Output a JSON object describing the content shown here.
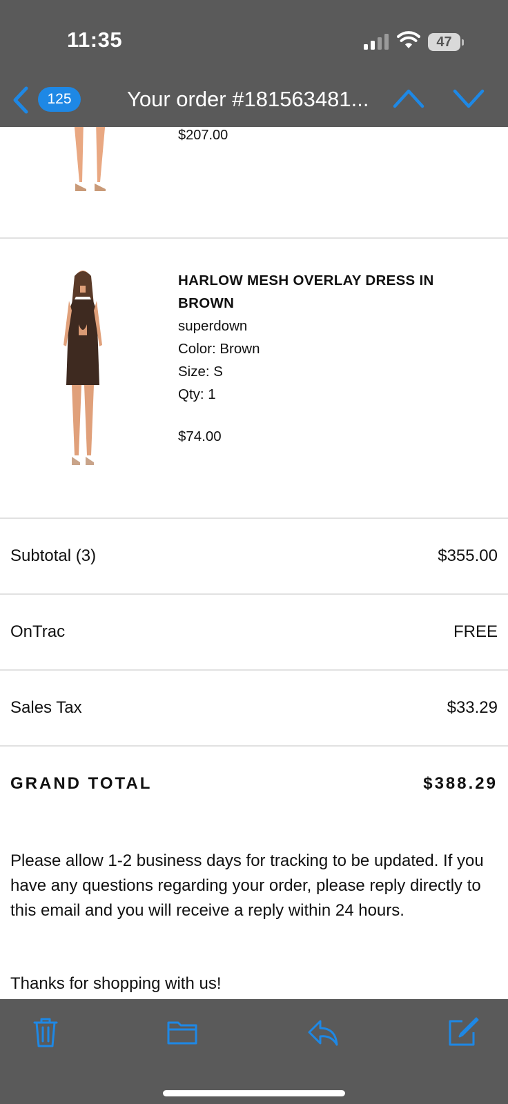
{
  "status_bar": {
    "time": "11:35",
    "battery": "47"
  },
  "nav": {
    "badge_count": "125",
    "title": "Your order #181563481..."
  },
  "previous_item": {
    "price": "$207.00"
  },
  "item": {
    "title": "HARLOW MESH OVERLAY DRESS IN BROWN",
    "brand": "superdown",
    "color": "Color: Brown",
    "size": "Size: S",
    "qty": "Qty: 1",
    "price": "$74.00"
  },
  "summary": {
    "subtotal_label": "Subtotal (3)",
    "subtotal_value": "$355.00",
    "shipping_label": "OnTrac",
    "shipping_value": "FREE",
    "tax_label": "Sales Tax",
    "tax_value": "$33.29",
    "grand_label": "GRAND TOTAL",
    "grand_value": "$388.29"
  },
  "message": {
    "note": "Please allow 1-2 business days for tracking to be updated. If you have any questions regarding your order, please reply directly to this email and you will receive a reply within 24 hours.",
    "thanks": "Thanks for shopping with us!"
  },
  "toolbar": {
    "icons": [
      "trash-icon",
      "folder-icon",
      "reply-icon",
      "compose-icon"
    ]
  },
  "colors": {
    "accent": "#1e88e5",
    "bar_background": "#5a5a5a"
  }
}
